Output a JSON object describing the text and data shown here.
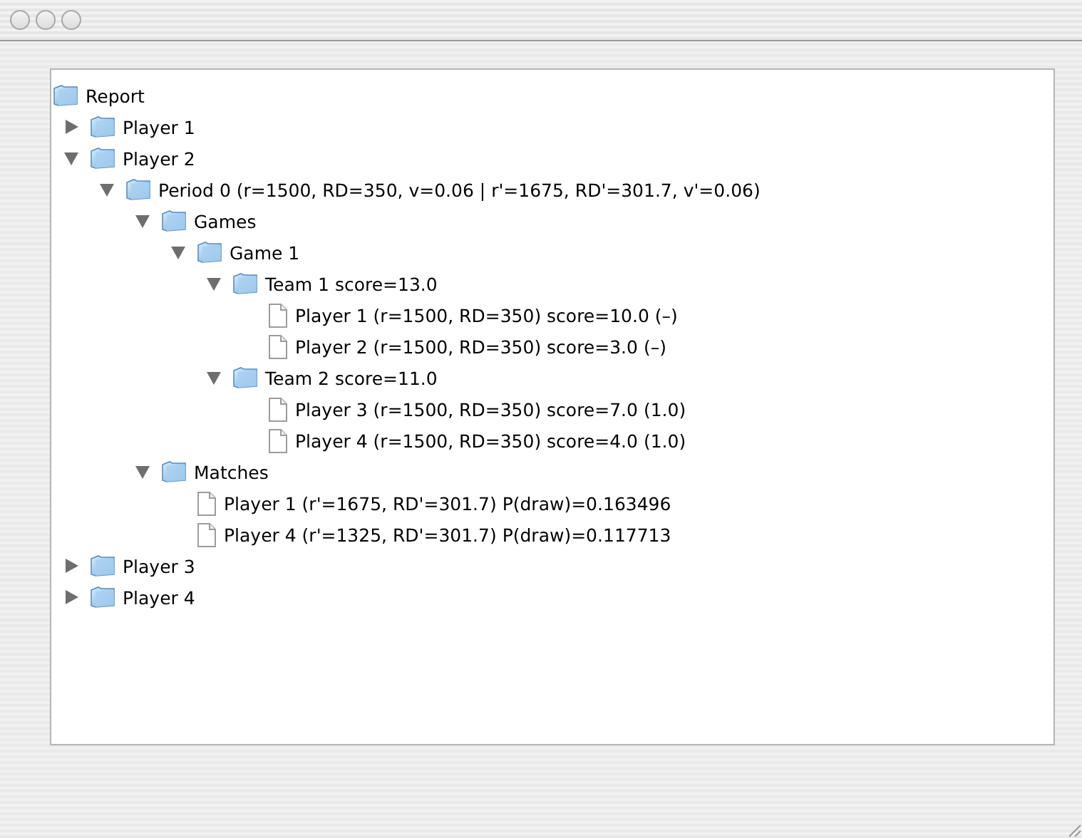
{
  "tree": {
    "label": "Report",
    "kind": "folder",
    "children": [
      {
        "label": "Player 1",
        "kind": "folder",
        "expanded": false
      },
      {
        "label": "Player 2",
        "kind": "folder",
        "expanded": true,
        "children": [
          {
            "label": "Period 0 (r=1500, RD=350, v=0.06 | r'=1675, RD'=301.7, v'=0.06)",
            "kind": "folder",
            "expanded": true,
            "children": [
              {
                "label": "Games",
                "kind": "folder",
                "expanded": true,
                "children": [
                  {
                    "label": "Game 1",
                    "kind": "folder",
                    "expanded": true,
                    "children": [
                      {
                        "label": "Team 1 score=13.0",
                        "kind": "folder",
                        "expanded": true,
                        "children": [
                          {
                            "label": "Player 1 (r=1500, RD=350) score=10.0 (–)",
                            "kind": "document"
                          },
                          {
                            "label": "Player 2 (r=1500, RD=350) score=3.0 (–)",
                            "kind": "document"
                          }
                        ]
                      },
                      {
                        "label": "Team 2 score=11.0",
                        "kind": "folder",
                        "expanded": true,
                        "children": [
                          {
                            "label": "Player 3 (r=1500, RD=350) score=7.0 (1.0)",
                            "kind": "document"
                          },
                          {
                            "label": "Player 4 (r=1500, RD=350) score=4.0 (1.0)",
                            "kind": "document"
                          }
                        ]
                      }
                    ]
                  }
                ]
              },
              {
                "label": "Matches",
                "kind": "folder",
                "expanded": true,
                "children": [
                  {
                    "label": "Player 1 (r'=1675, RD'=301.7) P(draw)=0.163496",
                    "kind": "document"
                  },
                  {
                    "label": "Player 4 (r'=1325, RD'=301.7) P(draw)=0.117713",
                    "kind": "document"
                  }
                ]
              }
            ]
          }
        ]
      },
      {
        "label": "Player 3",
        "kind": "folder",
        "expanded": false
      },
      {
        "label": "Player 4",
        "kind": "folder",
        "expanded": false
      }
    ]
  }
}
